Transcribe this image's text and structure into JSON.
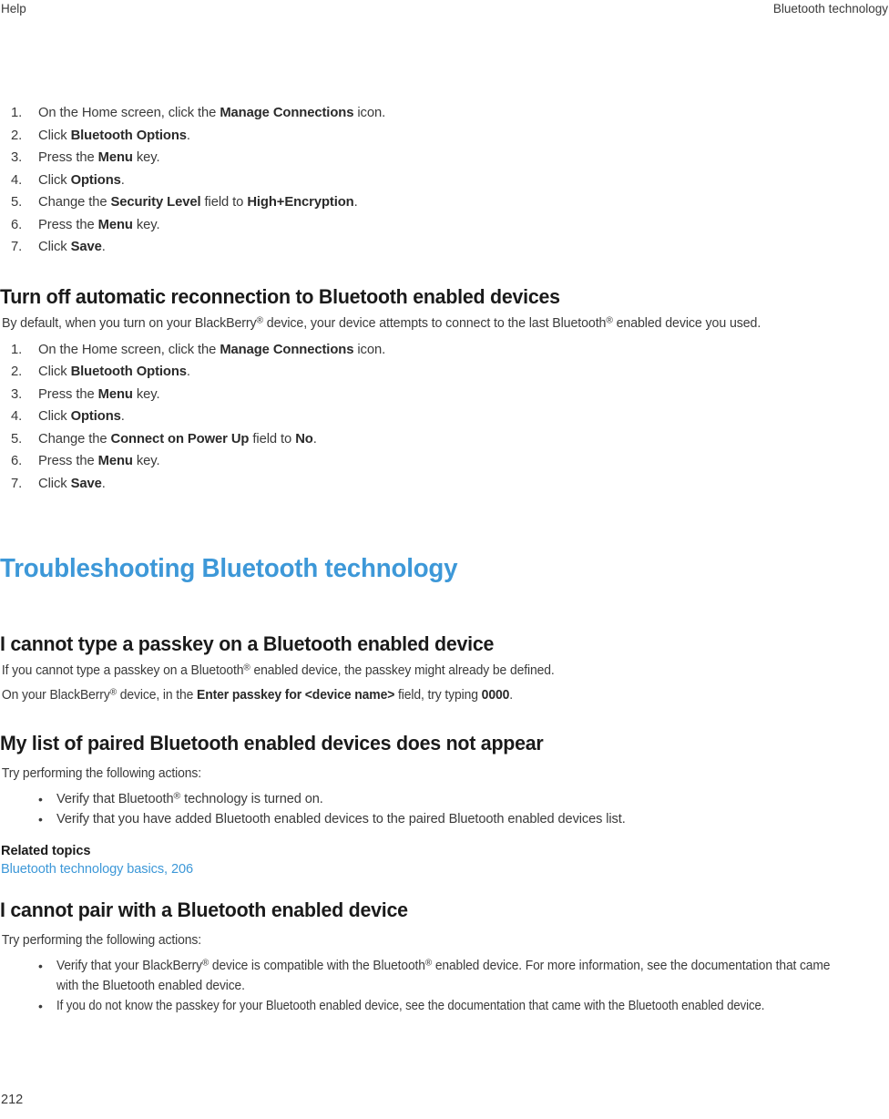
{
  "header": {
    "left": "Help",
    "right": "Bluetooth technology"
  },
  "footer": {
    "page_number": "212"
  },
  "colors": {
    "link": "#3d98d8",
    "chapter_heading": "#3d98d8",
    "body_text": "#3a3a3a",
    "heading_text": "#1a1a1a",
    "page_background": "#ffffff"
  },
  "steps_encryption": [
    {
      "num": "1.",
      "parts": [
        {
          "t": "On the Home screen, click the ",
          "b": false
        },
        {
          "t": "Manage Connections",
          "b": true
        },
        {
          "t": " icon.",
          "b": false
        }
      ]
    },
    {
      "num": "2.",
      "parts": [
        {
          "t": "Click ",
          "b": false
        },
        {
          "t": "Bluetooth Options",
          "b": true
        },
        {
          "t": ".",
          "b": false
        }
      ]
    },
    {
      "num": "3.",
      "parts": [
        {
          "t": "Press the ",
          "b": false
        },
        {
          "t": "Menu",
          "b": true
        },
        {
          "t": " key.",
          "b": false
        }
      ]
    },
    {
      "num": "4.",
      "parts": [
        {
          "t": "Click ",
          "b": false
        },
        {
          "t": "Options",
          "b": true
        },
        {
          "t": ".",
          "b": false
        }
      ]
    },
    {
      "num": "5.",
      "parts": [
        {
          "t": "Change the ",
          "b": false
        },
        {
          "t": "Security Level",
          "b": true
        },
        {
          "t": " field to ",
          "b": false
        },
        {
          "t": "High+Encryption",
          "b": true
        },
        {
          "t": ".",
          "b": false
        }
      ]
    },
    {
      "num": "6.",
      "parts": [
        {
          "t": "Press the ",
          "b": false
        },
        {
          "t": "Menu",
          "b": true
        },
        {
          "t": " key.",
          "b": false
        }
      ]
    },
    {
      "num": "7.",
      "parts": [
        {
          "t": "Click ",
          "b": false
        },
        {
          "t": "Save",
          "b": true
        },
        {
          "t": ".",
          "b": false
        }
      ]
    }
  ],
  "section_turn_off": {
    "heading": "Turn off automatic reconnection to Bluetooth enabled devices",
    "intro_parts": [
      {
        "t": "By default, when you turn on your BlackBerry",
        "b": false
      },
      {
        "t": "®",
        "b": false,
        "sup": true
      },
      {
        "t": " device, your device attempts to connect to the last Bluetooth",
        "b": false
      },
      {
        "t": "®",
        "b": false,
        "sup": true
      },
      {
        "t": " enabled device you used.",
        "b": false
      }
    ],
    "steps": [
      {
        "num": "1.",
        "parts": [
          {
            "t": "On the Home screen, click the ",
            "b": false
          },
          {
            "t": "Manage Connections",
            "b": true
          },
          {
            "t": " icon.",
            "b": false
          }
        ]
      },
      {
        "num": "2.",
        "parts": [
          {
            "t": "Click ",
            "b": false
          },
          {
            "t": "Bluetooth Options",
            "b": true
          },
          {
            "t": ".",
            "b": false
          }
        ]
      },
      {
        "num": "3.",
        "parts": [
          {
            "t": "Press the ",
            "b": false
          },
          {
            "t": "Menu",
            "b": true
          },
          {
            "t": " key.",
            "b": false
          }
        ]
      },
      {
        "num": "4.",
        "parts": [
          {
            "t": "Click ",
            "b": false
          },
          {
            "t": "Options",
            "b": true
          },
          {
            "t": ".",
            "b": false
          }
        ]
      },
      {
        "num": "5.",
        "parts": [
          {
            "t": "Change the ",
            "b": false
          },
          {
            "t": "Connect on Power Up",
            "b": true
          },
          {
            "t": " field to ",
            "b": false
          },
          {
            "t": "No",
            "b": true
          },
          {
            "t": ".",
            "b": false
          }
        ]
      },
      {
        "num": "6.",
        "parts": [
          {
            "t": "Press the ",
            "b": false
          },
          {
            "t": "Menu",
            "b": true
          },
          {
            "t": " key.",
            "b": false
          }
        ]
      },
      {
        "num": "7.",
        "parts": [
          {
            "t": "Click ",
            "b": false
          },
          {
            "t": "Save",
            "b": true
          },
          {
            "t": ".",
            "b": false
          }
        ]
      }
    ]
  },
  "chapter": {
    "title": "Troubleshooting Bluetooth technology"
  },
  "section_passkey": {
    "heading": "I cannot type a passkey on a Bluetooth enabled device",
    "para1_parts": [
      {
        "t": "If you cannot type a passkey on a Bluetooth",
        "b": false
      },
      {
        "t": "®",
        "b": false,
        "sup": true
      },
      {
        "t": " enabled device, the passkey might already be defined.",
        "b": false
      }
    ],
    "para2_parts": [
      {
        "t": "On your BlackBerry",
        "b": false
      },
      {
        "t": "®",
        "b": false,
        "sup": true
      },
      {
        "t": " device, in the ",
        "b": false
      },
      {
        "t": "Enter passkey for <device name>",
        "b": true
      },
      {
        "t": " field, try typing ",
        "b": false
      },
      {
        "t": "0000",
        "b": true
      },
      {
        "t": ".",
        "b": false
      }
    ]
  },
  "section_paired_list": {
    "heading": "My list of paired Bluetooth enabled devices does not appear",
    "intro": "Try performing the following actions:",
    "bullets": [
      {
        "parts": [
          {
            "t": "Verify that Bluetooth",
            "b": false
          },
          {
            "t": "®",
            "b": false,
            "sup": true
          },
          {
            "t": " technology is turned on.",
            "b": false
          }
        ]
      },
      {
        "parts": [
          {
            "t": "Verify that you have added Bluetooth enabled devices to the paired Bluetooth enabled devices list.",
            "b": false
          }
        ]
      }
    ],
    "related_topics_label": "Related topics",
    "related_link": "Bluetooth technology basics, 206"
  },
  "section_cannot_pair": {
    "heading": "I cannot pair with a Bluetooth enabled device",
    "intro": "Try performing the following actions:",
    "bullets": [
      {
        "parts": [
          {
            "t": "Verify that your BlackBerry",
            "b": false
          },
          {
            "t": "®",
            "b": false,
            "sup": true
          },
          {
            "t": " device is compatible with the Bluetooth",
            "b": false
          },
          {
            "t": "®",
            "b": false,
            "sup": true
          },
          {
            "t": " enabled device. For more information, see the documentation that came with the Bluetooth enabled device.",
            "b": false
          }
        ]
      },
      {
        "parts": [
          {
            "t": "If you do not know the passkey for your Bluetooth enabled device, see the documentation that came with the Bluetooth enabled device.",
            "b": false
          }
        ]
      }
    ]
  }
}
